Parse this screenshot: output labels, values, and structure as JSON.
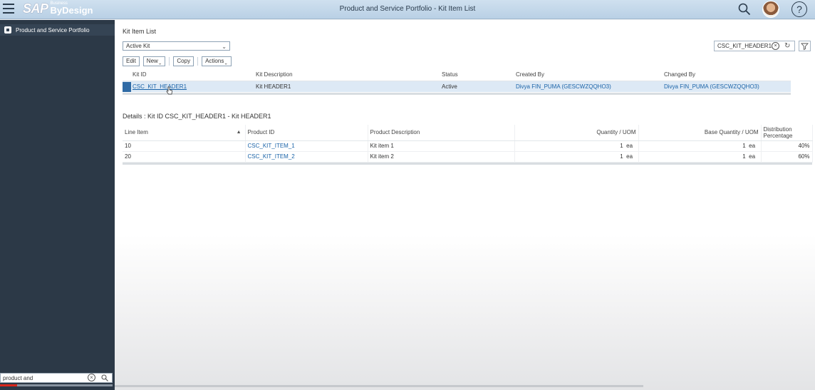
{
  "shell": {
    "title": "Product and Service Portfolio - Kit Item List",
    "logo_main": "SAP",
    "logo_business": "Business",
    "logo_product": "ByDesign",
    "help_glyph": "?"
  },
  "sidebar": {
    "items": [
      {
        "label": "Product and Service Portfolio",
        "icon": "cube-icon"
      }
    ],
    "search": {
      "value": "product and"
    },
    "progress_fraction": 0.15
  },
  "kit_list": {
    "title": "Kit Item List",
    "filter_value": "Active Kit",
    "search_value": "CSC_KIT_HEADER1",
    "toolbar": {
      "edit": "Edit",
      "new": "New",
      "copy": "Copy",
      "actions": "Actions"
    },
    "columns": [
      "Kit ID",
      "Kit Description",
      "Status",
      "Created By",
      "Changed By"
    ],
    "rows": [
      {
        "kit_id": "CSC_KIT_HEADER1",
        "description": "Kit HEADER1",
        "status": "Active",
        "created_by": "Divya FIN_PUMA (GESCWZQQHO3)",
        "changed_by": "Divya FIN_PUMA (GESCWZQQHO3)"
      }
    ]
  },
  "details": {
    "title": "Details : Kit ID CSC_KIT_HEADER1 - Kit HEADER1",
    "columns": [
      "Line Item",
      "Product ID",
      "Product Description",
      "Quantity / UOM",
      "Base Quantity / UOM",
      "Distribution Percentage"
    ],
    "rows": [
      {
        "line_item": "10",
        "product_id": "CSC_KIT_ITEM_1",
        "description": "Kit item 1",
        "qty": "1",
        "uom": "ea",
        "base_qty": "1",
        "base_uom": "ea",
        "dist": "40%"
      },
      {
        "line_item": "20",
        "product_id": "CSC_KIT_ITEM_2",
        "description": "Kit item 2",
        "qty": "1",
        "uom": "ea",
        "base_qty": "1",
        "base_uom": "ea",
        "dist": "60%"
      }
    ]
  },
  "colors": {
    "accent": "#1a63a8",
    "selection": "#dde9f5",
    "nav_bg": "#2c3947",
    "progress": "#d9261c"
  }
}
